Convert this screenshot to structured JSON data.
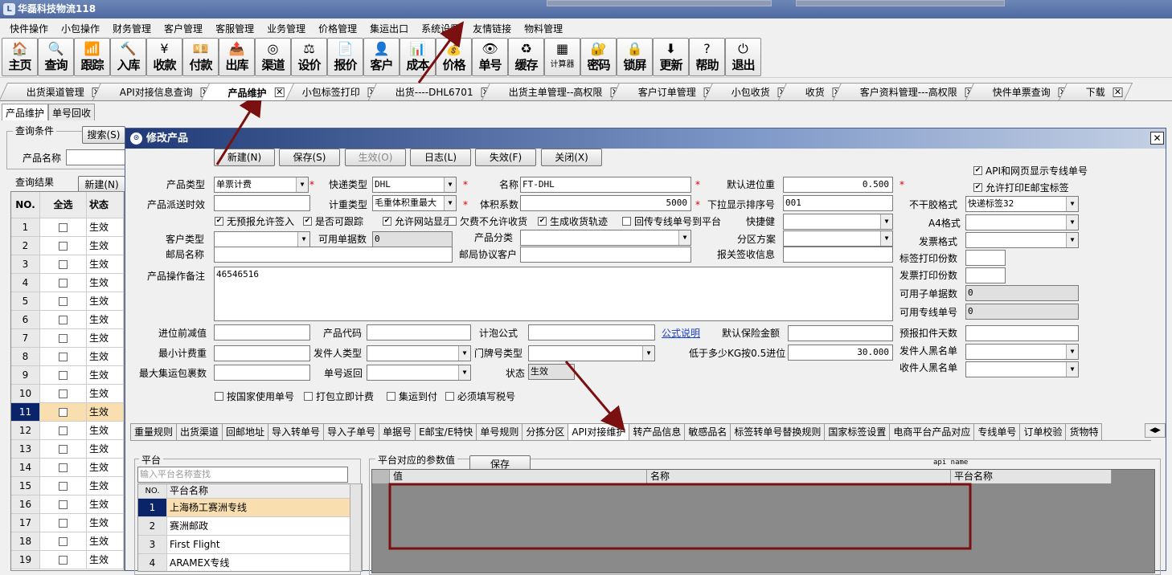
{
  "app": {
    "title": "华磊科技物流118"
  },
  "menu": [
    "快件操作",
    "小包操作",
    "财务管理",
    "客户管理",
    "客服管理",
    "业务管理",
    "价格管理",
    "集运出口",
    "系统设置",
    "友情链接",
    "物料管理"
  ],
  "toolbar": [
    {
      "label": "主页",
      "icon": "home-icon",
      "glyph": "🏠"
    },
    {
      "label": "查询",
      "icon": "magnifier-icon",
      "glyph": "🔍"
    },
    {
      "label": "跟踪",
      "icon": "signal-icon",
      "glyph": "📶"
    },
    {
      "label": "入库",
      "icon": "hammer-icon",
      "glyph": "🔨"
    },
    {
      "label": "收款",
      "icon": "yen-icon",
      "glyph": "¥"
    },
    {
      "label": "付款",
      "icon": "money-icon",
      "glyph": "💴"
    },
    {
      "label": "出库",
      "icon": "box-out-icon",
      "glyph": "📤"
    },
    {
      "label": "渠道",
      "icon": "cycle-icon",
      "glyph": "◎"
    },
    {
      "label": "设价",
      "icon": "scale-icon",
      "glyph": "⚖"
    },
    {
      "label": "报价",
      "icon": "document-icon",
      "glyph": "📄"
    },
    {
      "label": "客户",
      "icon": "user-icon",
      "glyph": "👤"
    },
    {
      "label": "成本",
      "icon": "chart-icon",
      "glyph": "📊"
    },
    {
      "label": "价格",
      "icon": "coins-icon",
      "glyph": "💰"
    },
    {
      "label": "单号",
      "icon": "eye-icon",
      "glyph": "👁"
    },
    {
      "label": "缓存",
      "icon": "refresh-icon",
      "glyph": "♻"
    },
    {
      "label": "计算器",
      "icon": "calculator-icon",
      "glyph": "▦"
    },
    {
      "label": "密码",
      "icon": "lock-key-icon",
      "glyph": "🔐"
    },
    {
      "label": "锁屏",
      "icon": "lock-icon",
      "glyph": "🔒"
    },
    {
      "label": "更新",
      "icon": "arrow-down-icon",
      "glyph": "⬇"
    },
    {
      "label": "帮助",
      "icon": "help-icon",
      "glyph": "?"
    },
    {
      "label": "退出",
      "icon": "power-icon",
      "glyph": "⏻"
    }
  ],
  "tabs": [
    {
      "label": "出货渠道管理"
    },
    {
      "label": "API对接信息查询"
    },
    {
      "label": "产品维护",
      "active": true
    },
    {
      "label": "小包标签打印"
    },
    {
      "label": "出货----DHL6701"
    },
    {
      "label": "出货主单管理--高权限"
    },
    {
      "label": "客户订单管理"
    },
    {
      "label": "小包收货"
    },
    {
      "label": "收货"
    },
    {
      "label": "客户资料管理---高权限"
    },
    {
      "label": "快件单票查询"
    },
    {
      "label": "下载"
    }
  ],
  "subtabs": [
    "产品维护",
    "单号回收"
  ],
  "query": {
    "group": "查询条件",
    "search": "搜索(S)",
    "name_label": "产品名称"
  },
  "results": {
    "group": "查询结果",
    "new": "新建(N)",
    "headers": [
      "NO.",
      "全选",
      "状态"
    ],
    "rows": [
      {
        "no": "1",
        "status": "生效"
      },
      {
        "no": "2",
        "status": "生效"
      },
      {
        "no": "3",
        "status": "生效"
      },
      {
        "no": "4",
        "status": "生效"
      },
      {
        "no": "5",
        "status": "生效"
      },
      {
        "no": "6",
        "status": "生效"
      },
      {
        "no": "7",
        "status": "生效"
      },
      {
        "no": "8",
        "status": "生效"
      },
      {
        "no": "9",
        "status": "生效"
      },
      {
        "no": "10",
        "status": "生效"
      },
      {
        "no": "11",
        "status": "生效",
        "selected": true
      },
      {
        "no": "12",
        "status": "生效"
      },
      {
        "no": "13",
        "status": "生效"
      },
      {
        "no": "14",
        "status": "生效"
      },
      {
        "no": "15",
        "status": "生效"
      },
      {
        "no": "16",
        "status": "生效"
      },
      {
        "no": "17",
        "status": "生效"
      },
      {
        "no": "18",
        "status": "生效"
      },
      {
        "no": "19",
        "status": "生效"
      }
    ]
  },
  "dialog": {
    "title": "修改产品",
    "buttons": [
      "新建(N)",
      "保存(S)",
      "生效(O)",
      "日志(L)",
      "失效(F)",
      "关闭(X)"
    ],
    "fields": {
      "product_type": {
        "label": "产品类型",
        "value": "单票计费"
      },
      "express_type": {
        "label": "快递类型",
        "value": "DHL"
      },
      "name": {
        "label": "名称",
        "value": "FT-DHL"
      },
      "default_carry_weight": {
        "label": "默认进位重",
        "value": "0.500"
      },
      "delivery_time": {
        "label": "产品派送时效",
        "value": ""
      },
      "weight_type": {
        "label": "计重类型",
        "value": "毛重体积重最大"
      },
      "volume_factor": {
        "label": "体积系数",
        "value": "5000"
      },
      "dropdown_order": {
        "label": "下拉显示排序号",
        "value": "001"
      },
      "sticker_format": {
        "label": "不干胶格式",
        "value": "快递标签32"
      },
      "shortcut": {
        "label": "快捷健",
        "value": ""
      },
      "a4_format": {
        "label": "A4格式",
        "value": ""
      },
      "customer_type": {
        "label": "客户类型",
        "value": ""
      },
      "available_docs": {
        "label": "可用单据数",
        "value": "0"
      },
      "product_category": {
        "label": "产品分类",
        "value": ""
      },
      "zone_scheme": {
        "label": "分区方案",
        "value": ""
      },
      "invoice_format": {
        "label": "发票格式",
        "value": ""
      },
      "post_name": {
        "label": "邮局名称",
        "value": ""
      },
      "post_customer": {
        "label": "邮局协议客户",
        "value": ""
      },
      "customs_info": {
        "label": "报关签收信息",
        "value": ""
      },
      "label_copies": {
        "label": "标签打印份数",
        "value": ""
      },
      "invoice_copies": {
        "label": "发票打印份数",
        "value": ""
      },
      "remark": {
        "label": "产品操作备注",
        "value": "46546516"
      },
      "sub_docs": {
        "label": "可用子单据数",
        "value": "0"
      },
      "dedicated_no": {
        "label": "可用专线单号",
        "value": "0"
      },
      "carry_deduct": {
        "label": "进位前减值",
        "value": ""
      },
      "product_code": {
        "label": "产品代码",
        "value": ""
      },
      "bubble_formula": {
        "label": "计泡公式",
        "value": ""
      },
      "formula_link": "公式说明",
      "default_insurance": {
        "label": "默认保险金额",
        "value": ""
      },
      "forecast_days": {
        "label": "预报扣件天数",
        "value": ""
      },
      "min_weight": {
        "label": "最小计费重",
        "value": ""
      },
      "sender_type": {
        "label": "发件人类型",
        "value": ""
      },
      "door_type": {
        "label": "门牌号类型",
        "value": ""
      },
      "kg_threshold": {
        "label": "低于多少KG按0.5进位",
        "value": "30.000"
      },
      "sender_blacklist": {
        "label": "发件人黑名单",
        "value": ""
      },
      "max_packages": {
        "label": "最大集运包裹数",
        "value": ""
      },
      "number_return": {
        "label": "单号返回",
        "value": ""
      },
      "status": {
        "label": "状态",
        "value": "生效"
      },
      "receiver_blacklist": {
        "label": "收件人黑名单",
        "value": ""
      }
    },
    "checks_row1": [
      {
        "label": "无预报允许签入",
        "checked": true
      },
      {
        "label": "是否可跟踪",
        "checked": true
      },
      {
        "label": "允许网站显示",
        "checked": true
      },
      {
        "label": "欠费不允许收货",
        "checked": false
      },
      {
        "label": "生成收货轨迹",
        "checked": true
      },
      {
        "label": "回传专线单号到平台",
        "checked": false
      }
    ],
    "checks_right": [
      {
        "label": "API和网页显示专线单号",
        "checked": true
      },
      {
        "label": "允许打印E邮宝标签",
        "checked": true
      }
    ],
    "checks_bottom": [
      {
        "label": "按国家使用单号",
        "checked": false
      },
      {
        "label": "打包立即计费",
        "checked": false
      },
      {
        "label": "集运到付",
        "checked": false
      },
      {
        "label": "必须填写税号",
        "checked": false
      }
    ],
    "bottom_tabs": [
      {
        "label": "重量规则"
      },
      {
        "label": "出货渠道"
      },
      {
        "label": "回邮地址"
      },
      {
        "label": "导入转单号"
      },
      {
        "label": "导入子单号"
      },
      {
        "label": "单据号"
      },
      {
        "label": "E邮宝/E特快"
      },
      {
        "label": "单号规则"
      },
      {
        "label": "分拣分区"
      },
      {
        "label": "API对接维护",
        "active": true
      },
      {
        "label": "转产品信息"
      },
      {
        "label": "敏感品名"
      },
      {
        "label": "标签转单号替换规则"
      },
      {
        "label": "国家标签设置"
      },
      {
        "label": "电商平台产品对应"
      },
      {
        "label": "专线单号"
      },
      {
        "label": "订单校验"
      },
      {
        "label": "货物特"
      }
    ],
    "platform": {
      "group": "平台",
      "placeholder": "输入平台名称查找",
      "headers": [
        "NO.",
        "平台名称"
      ],
      "rows": [
        {
          "no": "1",
          "name": "上海杨工赛洲专线",
          "selected": true
        },
        {
          "no": "2",
          "name": "赛洲邮政"
        },
        {
          "no": "3",
          "name": "First Flight"
        },
        {
          "no": "4",
          "name": "ARAMEX专线"
        }
      ]
    },
    "params": {
      "group": "平台对应的参数值",
      "save": "保存",
      "api_name": "api name",
      "headers": [
        "值",
        "名称",
        "平台名称"
      ]
    }
  },
  "colors": {
    "annotation": "#7a1010",
    "selected_row": "#f9dfb0"
  }
}
